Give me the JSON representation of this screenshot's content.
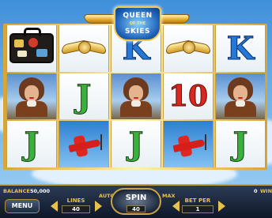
{
  "game": {
    "logo_line1": "QUEEN",
    "logo_line2": "OF THE",
    "logo_line3": "SKIES"
  },
  "reels": [
    [
      "suitcase",
      "pilot",
      "J"
    ],
    [
      "wings",
      "J",
      "plane"
    ],
    [
      "K",
      "pilot",
      "J"
    ],
    [
      "wings",
      "10",
      "plane"
    ],
    [
      "K",
      "pilot",
      "J"
    ]
  ],
  "colors": {
    "J": "#38b23d",
    "K": "#2378d8",
    "10": "#d8281f",
    "gold": "#e7c24b"
  },
  "controls": {
    "balance_label": "BALANCE",
    "balance_value": "50,000",
    "win_value": "0",
    "win_label": "WIN",
    "menu_label": "MENU",
    "lines_label": "LINES",
    "lines_value": "40",
    "auto_label": "AUTO",
    "spin_label": "SPIN",
    "spin_value": "40",
    "max_label": "MAX",
    "bet_per_label": "BET PER",
    "bet_per_value": "1"
  }
}
